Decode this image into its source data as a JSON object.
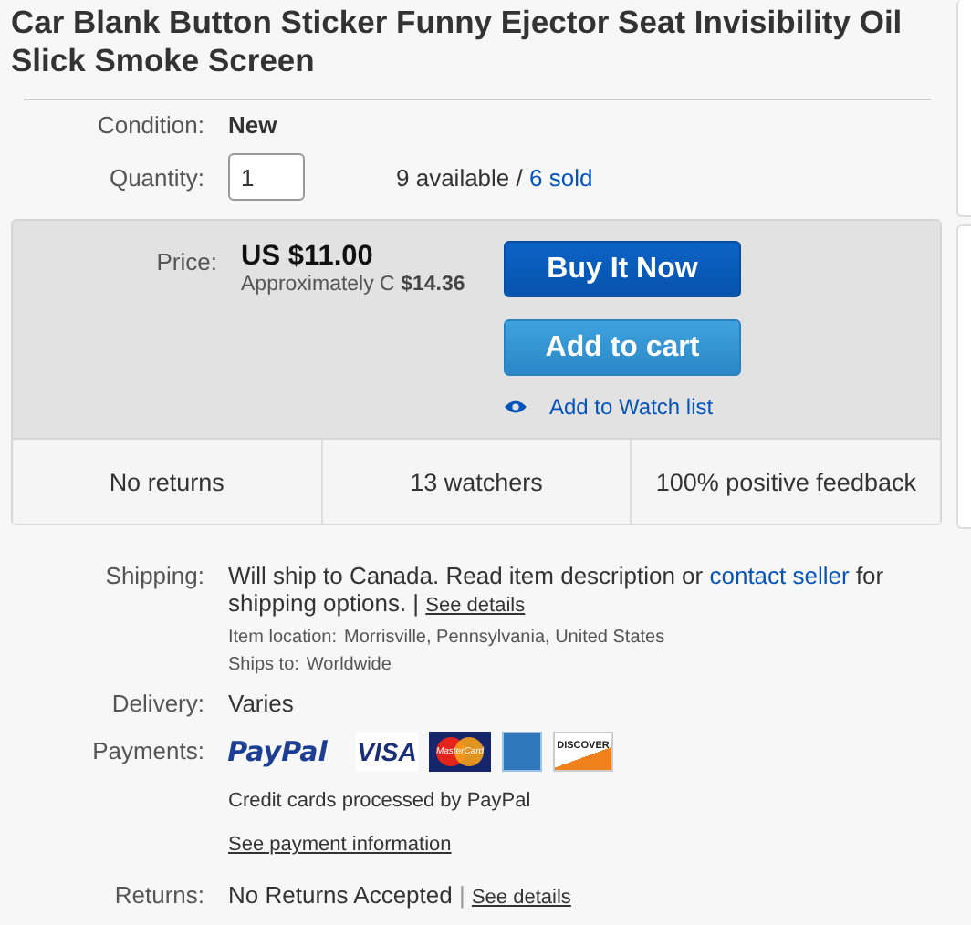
{
  "title": "Car Blank Button Sticker Funny Ejector Seat Invisibility Oil Slick Smoke Screen",
  "condition": {
    "label": "Condition:",
    "value": "New"
  },
  "quantity": {
    "label": "Quantity:",
    "value": "1",
    "available": "9 available / ",
    "sold": "6 sold"
  },
  "price": {
    "label": "Price:",
    "amount": "US $11.00",
    "approx_prefix": "Approximately C ",
    "approx_value": "$14.36"
  },
  "buttons": [
    {
      "kind": "primary",
      "label": "Buy It Now"
    },
    {
      "kind": "secondary",
      "label": "Add to cart"
    }
  ],
  "watch_link": "Add to Watch list",
  "highlights": [
    "No returns",
    "13 watchers",
    "100% positive feedback"
  ],
  "shipping": {
    "label": "Shipping:",
    "text_before": "Will ship to Canada. Read item description or ",
    "contact_link": "contact seller",
    "text_after": " for shipping options. | ",
    "details_link": "See details",
    "location_label": "Item location:",
    "location": "Morrisville, Pennsylvania, United States",
    "ships_to_label": "Ships to:",
    "ships_to": "Worldwide"
  },
  "delivery": {
    "label": "Delivery:",
    "value": "Varies"
  },
  "payments": {
    "label": "Payments:",
    "methods": [
      {
        "kind": "paypal",
        "text": "PayPal"
      },
      {
        "kind": "visa",
        "text": "VISA"
      },
      {
        "kind": "mastercard",
        "text": "MasterCard"
      },
      {
        "kind": "amex"
      },
      {
        "kind": "discover",
        "text": "DISCOVER"
      }
    ],
    "note": "Credit cards processed by PayPal",
    "info_link": "See payment information"
  },
  "returns": {
    "label": "Returns:",
    "value": "No Returns Accepted",
    "separator": " | ",
    "details_link": "See details"
  }
}
